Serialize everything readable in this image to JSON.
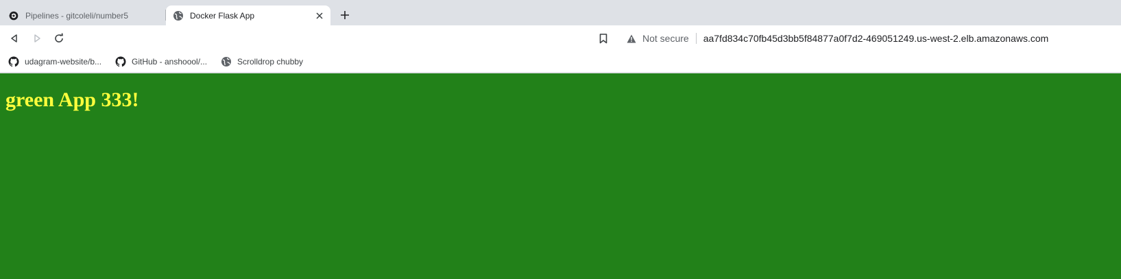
{
  "tabs": [
    {
      "title": "Pipelines - gitcoleli/number5",
      "active": false,
      "favicon": "circleci-icon"
    },
    {
      "title": "Docker Flask App",
      "active": true,
      "favicon": "globe-icon"
    }
  ],
  "new_tab_label": "+",
  "omnibox": {
    "security_label": "Not secure",
    "url": "aa7fd834c70fb45d3bb5f84877a0f7d2-469051249.us-west-2.elb.amazonaws.com"
  },
  "bookmarks": [
    {
      "label": "udagram-website/b...",
      "icon": "github-icon"
    },
    {
      "label": "GitHub - anshoool/...",
      "icon": "github-icon"
    },
    {
      "label": "Scrolldrop chubby",
      "icon": "globe-icon"
    }
  ],
  "page": {
    "heading": "green App 333!",
    "background_color": "#228119",
    "heading_color": "#ffff3d"
  }
}
